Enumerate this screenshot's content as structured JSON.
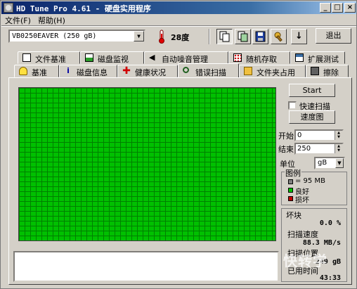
{
  "window": {
    "title": "HD Tune Pro 4.61 - 硬盘实用程序"
  },
  "menu": {
    "file": "文件(F)",
    "help": "帮助(H)"
  },
  "toolbar": {
    "drive": "VB0250EAVER (250 gB)",
    "temperature": "28度",
    "exit_label": "退出"
  },
  "tabs_top": [
    {
      "label": "文件基准",
      "icon": "file-icon"
    },
    {
      "label": "磁盘监视",
      "icon": "chart-icon"
    },
    {
      "label": "自动噪音管理",
      "icon": "speaker-icon"
    },
    {
      "label": "随机存取",
      "icon": "random-icon"
    },
    {
      "label": "扩展测试",
      "icon": "extended-icon"
    }
  ],
  "tabs_bottom": [
    {
      "label": "基准",
      "icon": "bulb-icon"
    },
    {
      "label": "磁盘信息",
      "icon": "info-icon"
    },
    {
      "label": "健康状况",
      "icon": "health-icon"
    },
    {
      "label": "错误扫描",
      "icon": "magnifier-icon",
      "active": true
    },
    {
      "label": "文件夹占用",
      "icon": "folder-icon"
    },
    {
      "label": "擦除",
      "icon": "trash-icon"
    }
  ],
  "scan": {
    "start_button": "Start",
    "quick_scan_label": "快速扫描",
    "quick_scan_checked": false,
    "speed_map_button": "速度图",
    "start_label": "开始",
    "start_value": "0",
    "end_label": "结束",
    "end_value": "250",
    "unit_label": "单位",
    "unit_value": "gB"
  },
  "legend": {
    "title": "图例",
    "block_size": "= 95 MB",
    "ok": "良好",
    "bad": "损坏",
    "colors": {
      "block": "#808080",
      "ok": "#00c000",
      "bad": "#c00000"
    }
  },
  "stats": {
    "bad_blocks_label": "坏块",
    "bad_blocks_value": "0.0 %",
    "scan_speed_label": "扫描速度",
    "scan_speed_value": "88.3 MB/s",
    "scan_position_label": "扫描位置",
    "scan_position_value": "249 gB",
    "elapsed_label": "已用时间",
    "elapsed_value": "43:33"
  },
  "watermark": "快转学"
}
